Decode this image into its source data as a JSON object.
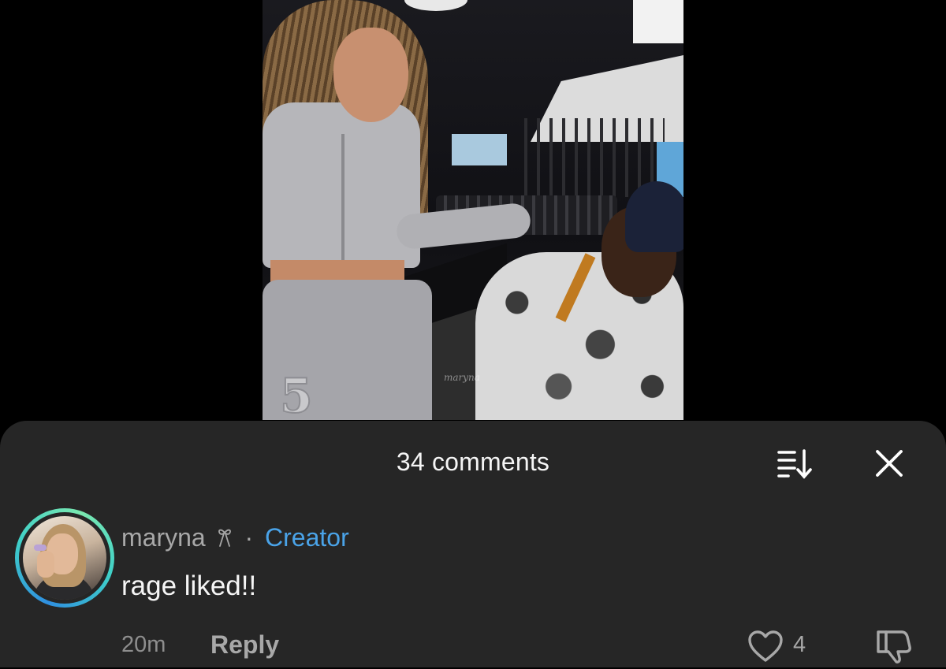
{
  "video": {
    "watermark": "maryna"
  },
  "comments_sheet": {
    "title": "34 comments",
    "sort_icon": "sort-icon",
    "close_icon": "close-icon"
  },
  "comment": {
    "username": "maryna",
    "badge_icon": "bow-icon",
    "separator": "·",
    "creator_label": "Creator",
    "text": "rage liked!!",
    "time": "20m",
    "reply_label": "Reply",
    "like_count": "4",
    "like_icon": "heart-icon",
    "dislike_icon": "thumbs-down-icon"
  },
  "colors": {
    "sheet_background": "#262626",
    "creator_accent": "#4aa3e8",
    "avatar_ring": [
      "#2f8fe0",
      "#3fd0c8",
      "#7ae8b0"
    ]
  }
}
